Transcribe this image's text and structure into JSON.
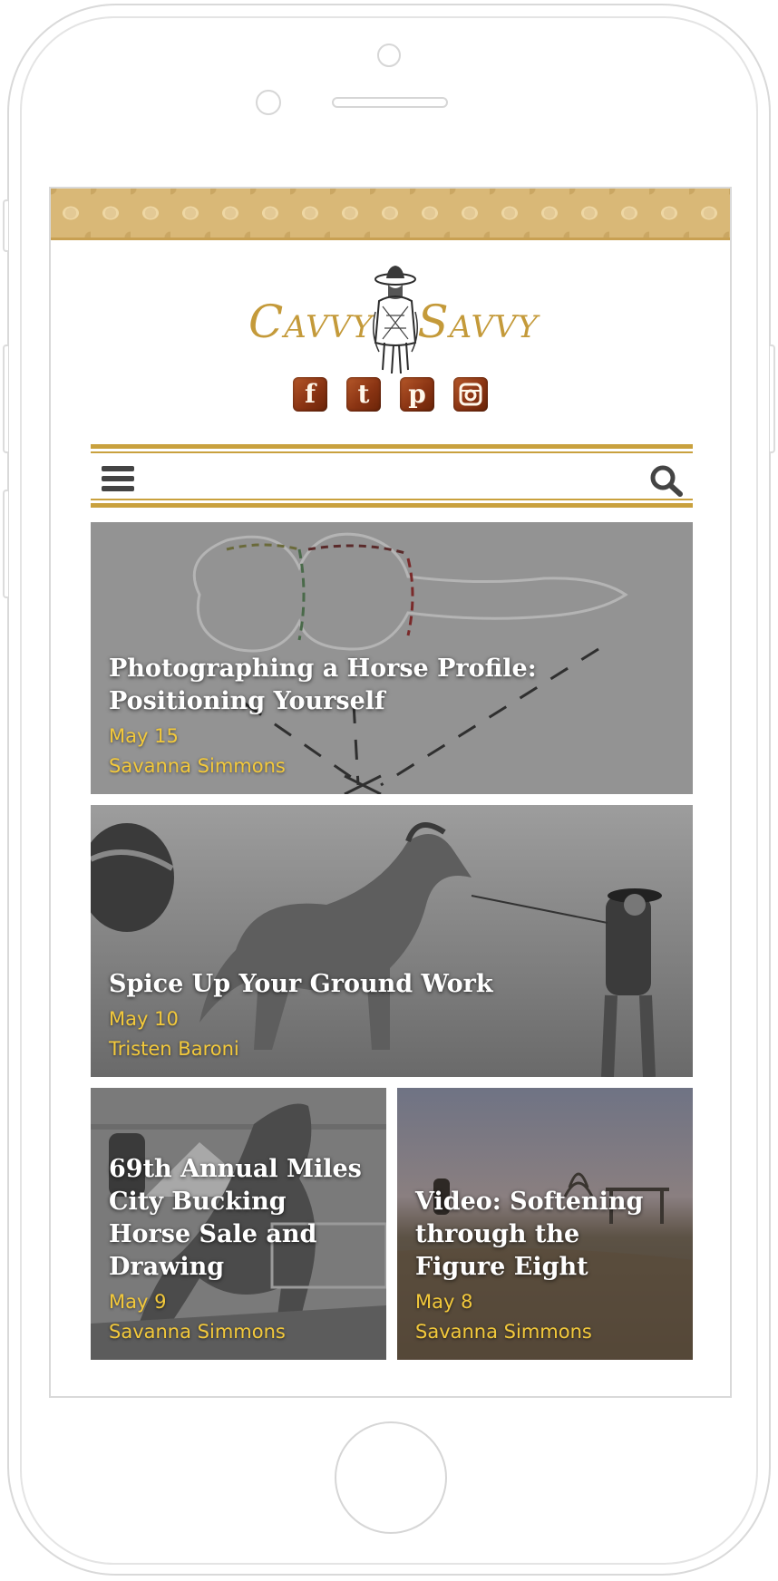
{
  "brand": {
    "logo_text_left": "Cavvy",
    "logo_text_right": "Savvy"
  },
  "social": [
    {
      "name": "facebook",
      "glyph": "f"
    },
    {
      "name": "twitter",
      "glyph": "t"
    },
    {
      "name": "pinterest",
      "glyph": "p"
    },
    {
      "name": "instagram",
      "glyph": ""
    }
  ],
  "colors": {
    "accent_gold": "#c9a13e",
    "meta_yellow": "#f3c93b",
    "social_brown": "#8a3413"
  },
  "articles": [
    {
      "title": "Photographing a Horse Profile: Positioning Yourself",
      "date": "May 15",
      "author": "Savanna Simmons"
    },
    {
      "title": "Spice Up Your Ground Work",
      "date": "May 10",
      "author": "Tristen Baroni"
    },
    {
      "title": "69th Annual Miles City Bucking Horse Sale and Drawing",
      "date": "May 9",
      "author": "Savanna Simmons"
    },
    {
      "title": "Video: Softening through the Figure Eight",
      "date": "May 8",
      "author": "Savanna Simmons"
    }
  ]
}
